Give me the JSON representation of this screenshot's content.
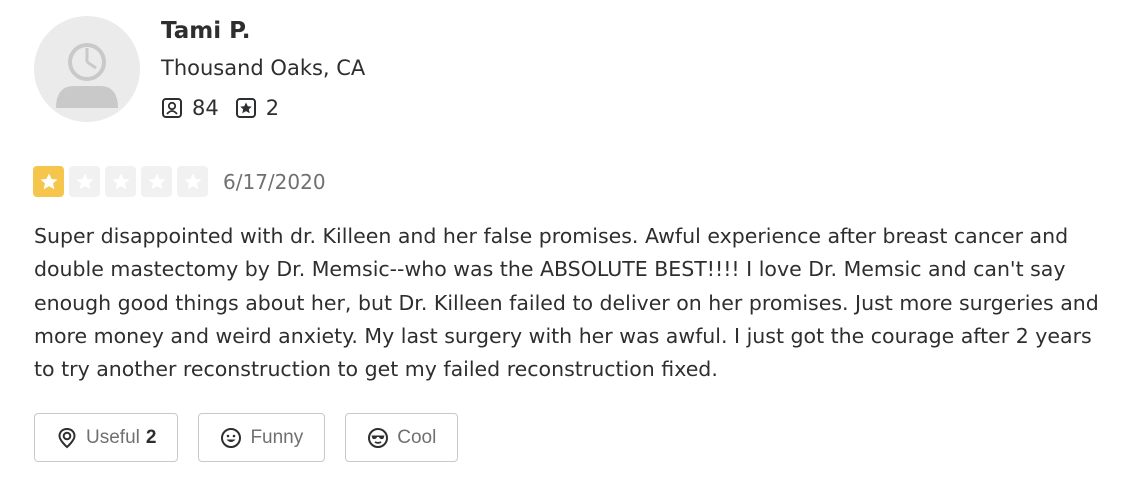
{
  "reviewer": {
    "name": "Tami P.",
    "location": "Thousand Oaks, CA",
    "review_count": "84",
    "photo_count": "2",
    "avatar_icon": "default-user-avatar"
  },
  "review": {
    "rating": 1,
    "rating_max": 5,
    "date": "6/17/2020",
    "text": "Super disappointed with dr. Killeen and her false promises. Awful experience after breast cancer and double mastectomy by Dr. Memsic--who was the ABSOLUTE BEST!!!! I love Dr. Memsic and can't say enough good things about her, but Dr. Killeen failed to deliver on her promises.  Just more surgeries and more money and weird anxiety. My last surgery with her was awful.  I just got the courage after 2 years to try another reconstruction to get my failed reconstruction fixed."
  },
  "actions": {
    "useful": {
      "label": "Useful",
      "count": "2",
      "icon": "lightbulb-icon"
    },
    "funny": {
      "label": "Funny",
      "icon": "smile-icon"
    },
    "cool": {
      "label": "Cool",
      "icon": "sunglasses-icon"
    }
  },
  "colors": {
    "star_active": "#f6c64c",
    "star_inactive": "#f1f1f1",
    "text_primary": "#2d2e2f",
    "text_secondary": "#6e7072"
  }
}
